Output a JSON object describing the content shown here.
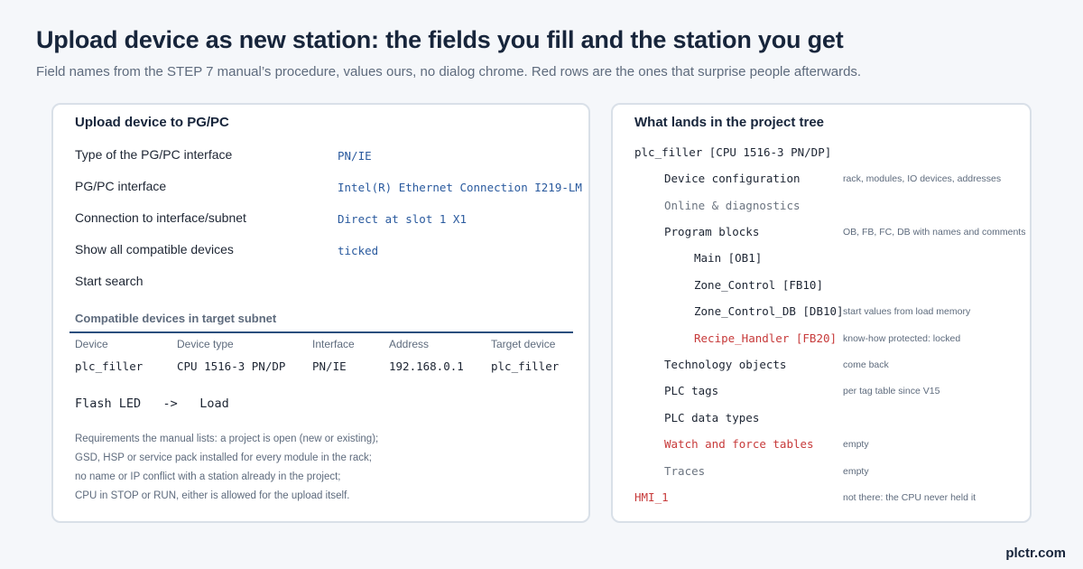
{
  "title": "Upload device as new station: the fields you fill and the station you get",
  "subtitle": "Field names from the STEP 7 manual’s procedure, values ours, no dialog chrome. Red rows are the ones that surprise people afterwards.",
  "left_card": {
    "title": "Upload device to PG/PC",
    "fields": [
      {
        "label": "Type of the PG/PC interface",
        "value": "PN/IE"
      },
      {
        "label": "PG/PC interface",
        "value": "Intel(R) Ethernet Connection I219-LM"
      },
      {
        "label": "Connection to interface/subnet",
        "value": "Direct at slot 1 X1"
      },
      {
        "label": "Show all compatible devices",
        "value": "ticked"
      },
      {
        "label": "Start search",
        "value": ""
      }
    ],
    "subnet": {
      "title": "Compatible devices in target subnet",
      "headers": [
        "Device",
        "Device type",
        "Interface",
        "Address",
        "Target device"
      ],
      "row": [
        "plc_filler",
        "CPU 1516-3 PN/DP",
        "PN/IE",
        "192.168.0.1",
        "plc_filler"
      ]
    },
    "actions": {
      "flash_led": "Flash LED",
      "arrow": "->",
      "load": "Load"
    },
    "requirements": [
      "Requirements the manual lists: a project is open (new or existing);",
      "GSD, HSP or service pack installed for every module in the rack;",
      "no name or IP conflict with a station already in the project;",
      "CPU in STOP or RUN, either is allowed for the upload itself."
    ]
  },
  "right_card": {
    "title": "What lands in the project tree",
    "tree": [
      {
        "label": "plc_filler [CPU 1516-3 PN/DP]",
        "note": "",
        "status": "normal"
      },
      {
        "label": "Device configuration",
        "note": "rack, modules, IO devices, addresses",
        "status": "normal"
      },
      {
        "label": "Online & diagnostics",
        "note": "",
        "status": "muted"
      },
      {
        "label": "Program blocks",
        "note": "OB, FB, FC, DB with names and comments",
        "status": "normal"
      },
      {
        "label": "Main [OB1]",
        "note": "",
        "status": "normal"
      },
      {
        "label": "Zone_Control [FB10]",
        "note": "",
        "status": "normal"
      },
      {
        "label": "Zone_Control_DB [DB10]",
        "note": "start values from load memory",
        "status": "normal"
      },
      {
        "label": "Recipe_Handler [FB20]",
        "note": "know-how protected: locked",
        "status": "alert"
      },
      {
        "label": "Technology objects",
        "note": "come back",
        "status": "normal"
      },
      {
        "label": "PLC tags",
        "note": "per tag table since V15",
        "status": "normal"
      },
      {
        "label": "PLC data types",
        "note": "",
        "status": "normal"
      },
      {
        "label": "Watch and force tables",
        "note": "empty",
        "status": "alert"
      },
      {
        "label": "Traces",
        "note": "empty",
        "status": "muted"
      },
      {
        "label": "HMI_1",
        "note": "not there: the CPU never held it",
        "status": "alert"
      }
    ]
  },
  "brand": "plctr.com",
  "colors": {
    "accent_blue": "#2a5a9e",
    "alert_red": "#c73a3a",
    "muted_gray": "#6b7480",
    "rule_navy": "#2b4f7e"
  }
}
